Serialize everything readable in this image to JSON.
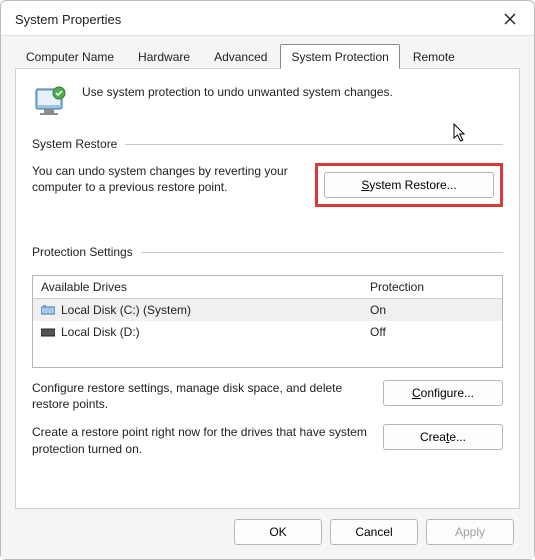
{
  "title": "System Properties",
  "tabs": {
    "computer_name": "Computer Name",
    "hardware": "Hardware",
    "advanced": "Advanced",
    "system_protection": "System Protection",
    "remote": "Remote"
  },
  "intro": "Use system protection to undo unwanted system changes.",
  "restore": {
    "heading": "System Restore",
    "text": "You can undo system changes by reverting your computer to a previous restore point.",
    "button": "System Restore..."
  },
  "protection": {
    "heading": "Protection Settings",
    "col_drives": "Available Drives",
    "col_protection": "Protection",
    "rows": [
      {
        "drive": "Local Disk (C:) (System)",
        "status": "On"
      },
      {
        "drive": "Local Disk (D:)",
        "status": "Off"
      }
    ],
    "configure_text": "Configure restore settings, manage disk space, and delete restore points.",
    "configure_button": "Configure...",
    "create_text": "Create a restore point right now for the drives that have system protection turned on.",
    "create_button": "Create..."
  },
  "footer": {
    "ok": "OK",
    "cancel": "Cancel",
    "apply": "Apply"
  }
}
